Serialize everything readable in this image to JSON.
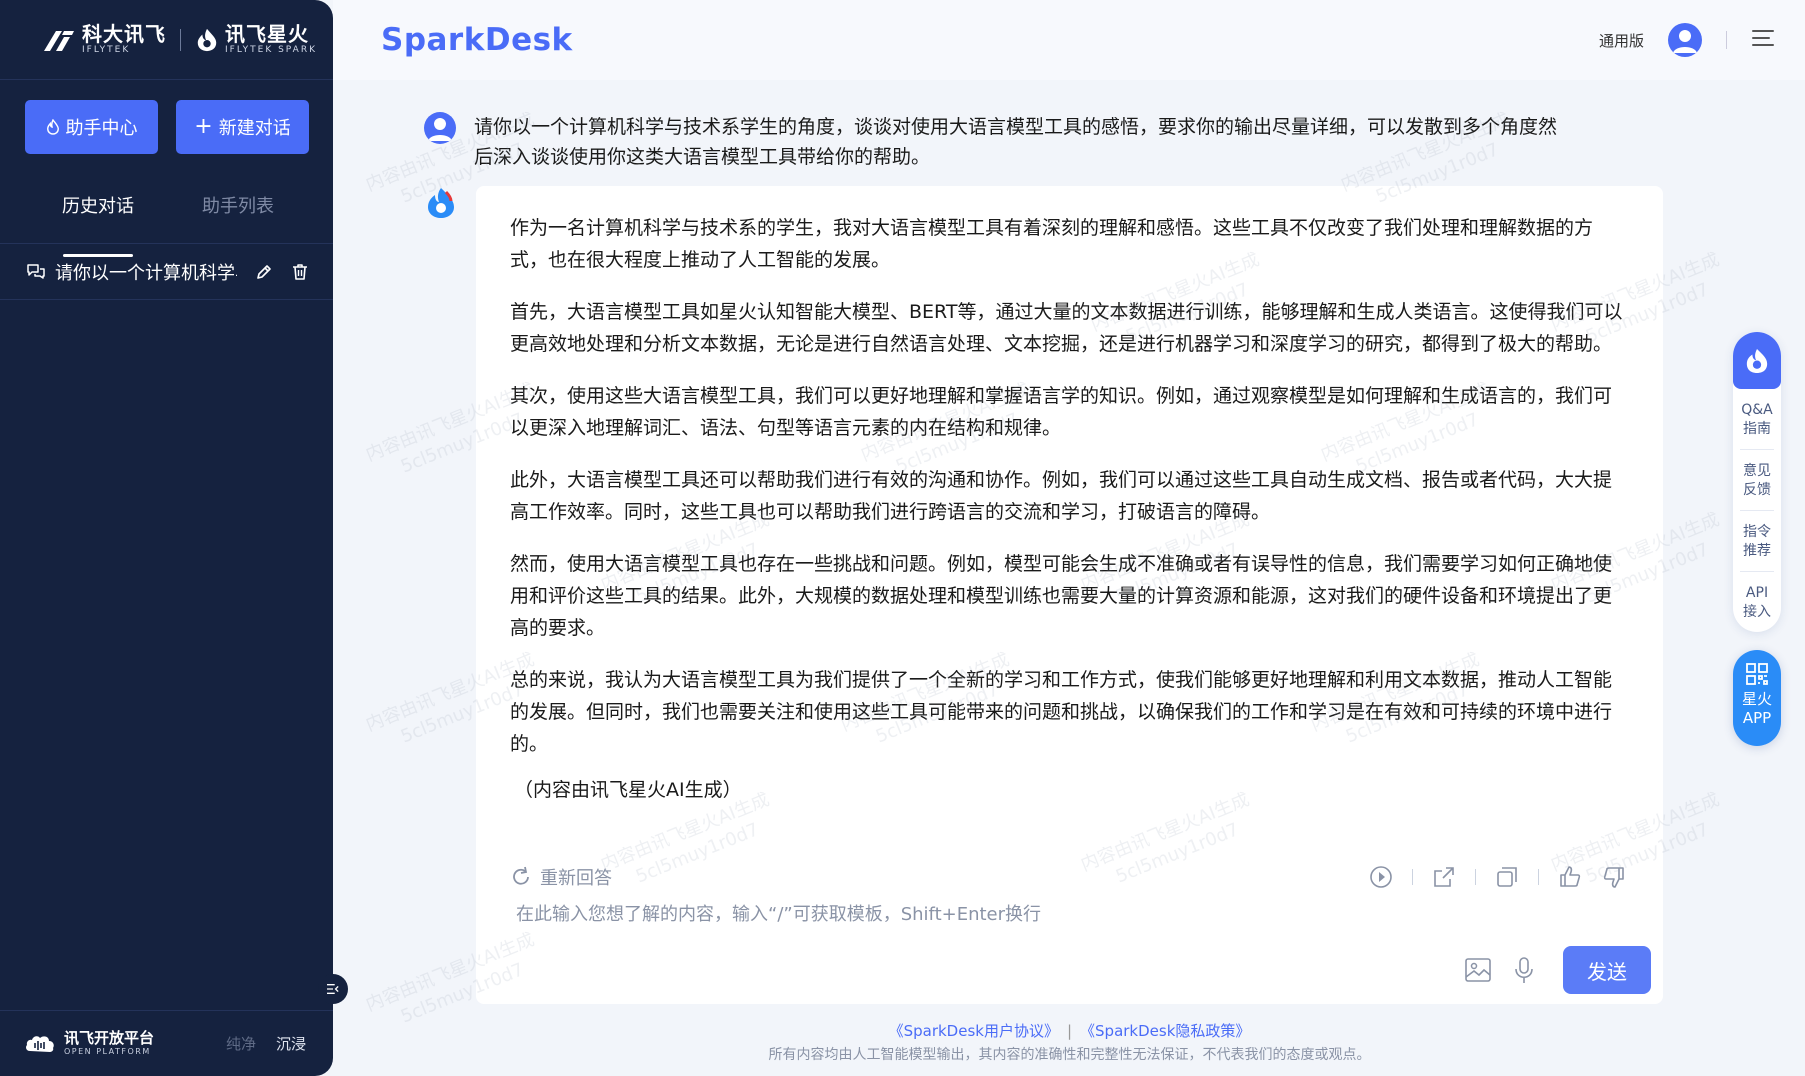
{
  "sidebar": {
    "logo_iflytek_cn": "科大讯飞",
    "logo_iflytek_en": "IFLYTEK",
    "logo_spark_cn": "讯飞星火",
    "logo_spark_en": "IFLYTEK SPARK",
    "help_button": "助手中心",
    "new_chat_button": "新建对话",
    "tabs": [
      {
        "label": "历史对话",
        "active": true
      },
      {
        "label": "助手列表",
        "active": false
      }
    ],
    "history": [
      {
        "title": "请你以一个计算机科学与技术系学生的角度"
      }
    ],
    "platform_cn": "讯飞开放平台",
    "platform_en": "OPEN PLATFORM",
    "mode_plain": "纯净",
    "mode_immersive": "沉浸"
  },
  "header": {
    "brand": "SparkDesk",
    "version": "通用版"
  },
  "chat": {
    "user_message": "请你以一个计算机科学与技术系学生的角度，谈谈对使用大语言模型工具的感悟，要求你的输出尽量详细，可以发散到多个角度然后深入谈谈使用你这类大语言模型工具带给你的帮助。",
    "answer_paragraphs": [
      "作为一名计算机科学与技术系的学生，我对大语言模型工具有着深刻的理解和感悟。这些工具不仅改变了我们处理和理解数据的方式，也在很大程度上推动了人工智能的发展。",
      "首先，大语言模型工具如星火认知智能大模型、BERT等，通过大量的文本数据进行训练，能够理解和生成人类语言。这使得我们可以更高效地处理和分析文本数据，无论是进行自然语言处理、文本挖掘，还是进行机器学习和深度学习的研究，都得到了极大的帮助。",
      "其次，使用这些大语言模型工具，我们可以更好地理解和掌握语言学的知识。例如，通过观察模型是如何理解和生成语言的，我们可以更深入地理解词汇、语法、句型等语言元素的内在结构和规律。",
      "此外，大语言模型工具还可以帮助我们进行有效的沟通和协作。例如，我们可以通过这些工具自动生成文档、报告或者代码，大大提高工作效率。同时，这些工具也可以帮助我们进行跨语言的交流和学习，打破语言的障碍。",
      "然而，使用大语言模型工具也存在一些挑战和问题。例如，模型可能会生成不准确或者有误导性的信息，我们需要学习如何正确地使用和评价这些工具的结果。此外，大规模的数据处理和模型训练也需要大量的计算资源和能源，这对我们的硬件设备和环境提出了更高的要求。",
      "总的来说，我认为大语言模型工具为我们提供了一个全新的学习和工作方式，使我们能够更好地理解和利用文本数据，推动人工智能的发展。但同时，我们也需要关注和使用这些工具可能带来的问题和挑战，以确保我们的工作和学习是在有效和可持续的环境中进行的。"
    ],
    "ai_note": "（内容由讯飞星火AI生成）",
    "regenerate": "重新回答",
    "input_placeholder": "在此输入您想了解的内容，输入“/”可获取模板，Shift+Enter换行",
    "send_button": "发送"
  },
  "footer": {
    "user_agreement": "《SparkDesk用户协议》",
    "separator": "|",
    "privacy_policy": "《SparkDesk隐私政策》",
    "disclaimer": "所有内容均由人工智能模型输出，其内容的准确性和完整性无法保证，不代表我们的态度或观点。"
  },
  "float_bar": {
    "items": [
      {
        "line1": "Q&A",
        "line2": "指南"
      },
      {
        "line1": "意见",
        "line2": "反馈"
      },
      {
        "line1": "指令",
        "line2": "推荐"
      },
      {
        "line1": "API",
        "line2": "接入"
      }
    ],
    "app_line1": "星火",
    "app_line2": "APP"
  },
  "watermark": {
    "line1": "内容由讯飞星火AI生成",
    "line2": "5cl5muy1r0d7"
  },
  "colors": {
    "sidebar_bg": "#15223f",
    "accent": "#4a6cf7",
    "app_blue": "#2a8cf7",
    "page_bg": "#f2f5fa"
  },
  "icons": {
    "help": "flame-icon",
    "new_chat": "plus-icon",
    "history_item": "chat-bubbles-icon",
    "edit": "pencil-icon",
    "delete": "trash-icon",
    "menu": "hamburger-icon",
    "regenerate": "refresh-icon",
    "play": "play-icon",
    "share": "share-icon",
    "copy": "copy-icon",
    "like": "thumbs-up-icon",
    "dislike": "thumbs-down-icon",
    "image": "image-icon",
    "mic": "microphone-icon"
  }
}
